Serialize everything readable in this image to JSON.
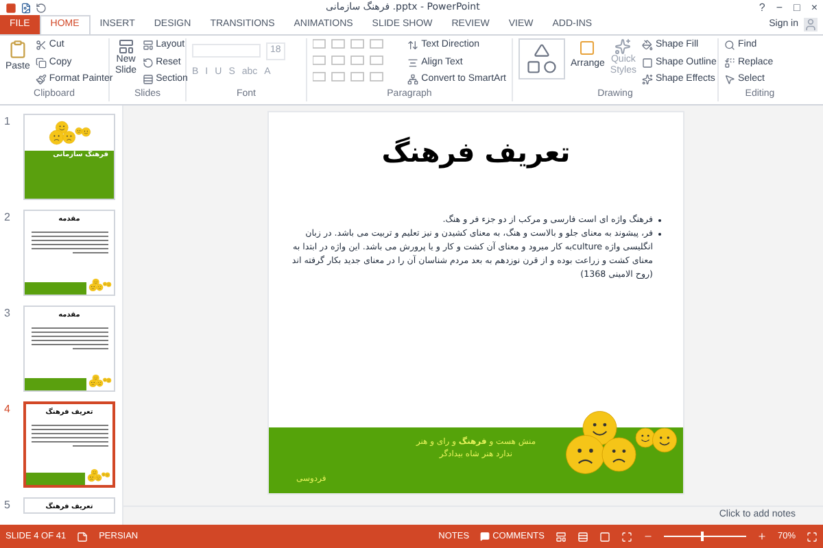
{
  "window": {
    "title": "فرهنگ سازمانی .pptx - PowerPoint",
    "controls": [
      "?",
      "−",
      "□",
      "×"
    ]
  },
  "tabs": [
    {
      "label": "FILE",
      "kind": "file",
      "selected": false
    },
    {
      "label": "HOME",
      "kind": "tab",
      "selected": true
    },
    {
      "label": "INSERT",
      "kind": "tab",
      "selected": false
    },
    {
      "label": "DESIGN",
      "kind": "tab",
      "selected": false
    },
    {
      "label": "TRANSITIONS",
      "kind": "tab",
      "selected": false
    },
    {
      "label": "ANIMATIONS",
      "kind": "tab",
      "selected": false
    },
    {
      "label": "SLIDE SHOW",
      "kind": "tab",
      "selected": false
    },
    {
      "label": "REVIEW",
      "kind": "tab",
      "selected": false
    },
    {
      "label": "VIEW",
      "kind": "tab",
      "selected": false
    },
    {
      "label": "ADD-INS",
      "kind": "tab",
      "selected": false
    }
  ],
  "sign_in": "Sign in",
  "ribbon": {
    "clipboard": {
      "label": "Clipboard",
      "paste": "Paste",
      "items": [
        "Cut",
        "Copy",
        "Format Painter"
      ]
    },
    "slides": {
      "label": "Slides",
      "new_slide": [
        "New",
        "Slide"
      ],
      "items": [
        "Layout",
        "Reset",
        "Section"
      ]
    },
    "font": {
      "label": "Font",
      "size": "18",
      "buttons": [
        "B",
        "I",
        "U",
        "S",
        "abc",
        "A"
      ]
    },
    "paragraph": {
      "label": "Paragraph",
      "items": [
        "Text Direction",
        "Align Text",
        "Convert to SmartArt"
      ]
    },
    "drawing": {
      "label": "Drawing",
      "arrange": "Arrange",
      "quick_styles": [
        "Quick",
        "Styles"
      ],
      "items": [
        "Shape Fill",
        "Shape Outline",
        "Shape Effects"
      ]
    },
    "editing": {
      "label": "Editing",
      "items": [
        "Find",
        "Replace",
        "Select"
      ]
    }
  },
  "slides": [
    {
      "number": "1",
      "title": "فرهنگ سازمانی",
      "kind": "cover",
      "selected": false
    },
    {
      "number": "2",
      "title": "مقدمه",
      "kind": "text",
      "selected": false
    },
    {
      "number": "3",
      "title": "مقدمه",
      "kind": "text",
      "selected": false
    },
    {
      "number": "4",
      "title": "تعریف فرهنگ",
      "kind": "text",
      "selected": true
    },
    {
      "number": "5",
      "title": "تعریف فرهنگ",
      "kind": "partial",
      "selected": false
    }
  ],
  "slide": {
    "title": "تعریف فرهنگ",
    "bullets": [
      "فرهنگ واژه ای است  فارسی و مرکب از دو جزء فر و هنگ.",
      "فر، پیشوند به معنای جلو و بالاست و هنگ، به معنای کشیدن و نیز تعلیم و تربیت می باشد. در زبان انگلیسی واژه cultureبه کار میرود و معنای آن کشت و کار و یا پرورش می باشد. این واژه در ابتدا به معنای کشت و زراعت بوده و از قرن نوزدهم به بعد مردم شناسان آن را در معنای جدید بکار گرفته اند (روح الامینی 1368)"
    ],
    "poem": [
      "منش هست و **فرهنگ** و رای و هنر",
      "ندارد هنر شاه بیدادگر"
    ],
    "poet": "فردوسی"
  },
  "notes_placeholder": "Click to add notes",
  "status_bar": {
    "slide": "SLIDE 4 OF 41",
    "language": "PERSIAN",
    "notes": "NOTES",
    "comments": "COMMENTS",
    "zoom": "70%",
    "level": 0.45
  }
}
